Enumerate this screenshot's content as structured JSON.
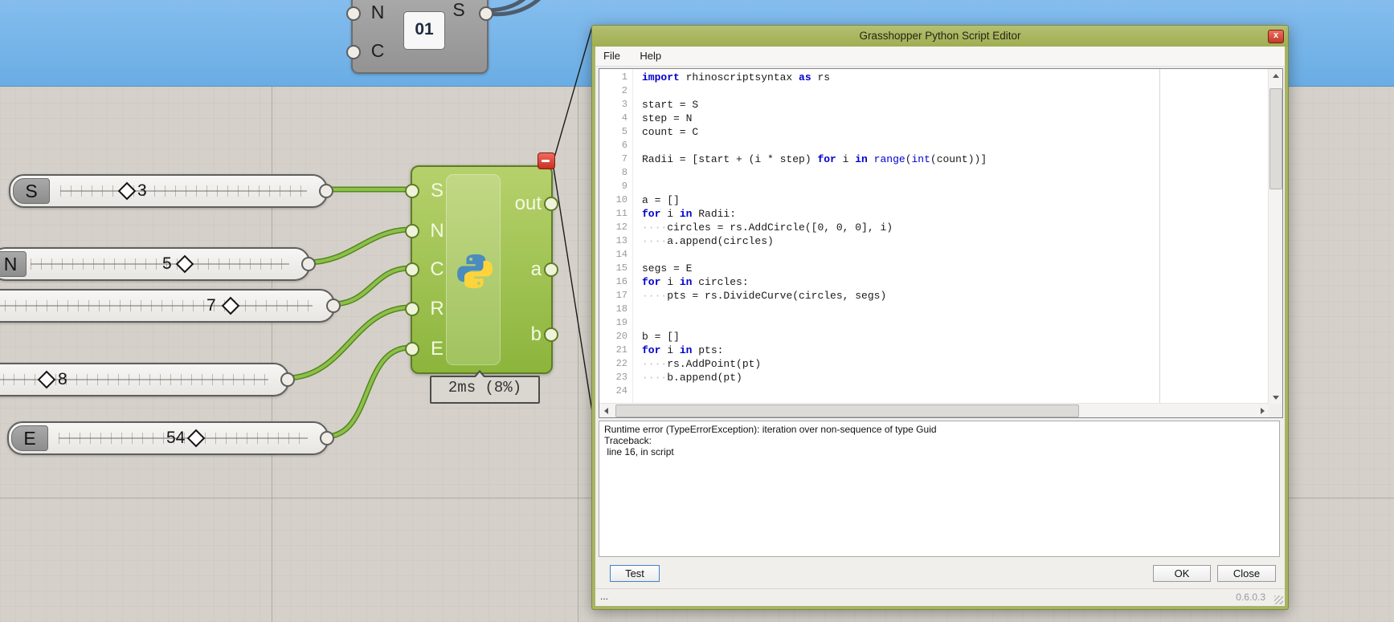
{
  "colors": {
    "sky": "#79b6e8",
    "canvas": "#d5d1ca",
    "accent_olive": "#a9b464",
    "wire_green": "#7db63e",
    "component_green": "#9cc04a",
    "error_red": "#d64541"
  },
  "canvas": {
    "series_component": {
      "input_top": "N",
      "input_bottom": "C",
      "output_label": "S",
      "icon_text": "01"
    },
    "sliders": [
      {
        "label": "S",
        "value": "3"
      },
      {
        "label": "N",
        "value": "5"
      },
      {
        "label": "",
        "value": "7"
      },
      {
        "label": "",
        "value": "8"
      },
      {
        "label": "E",
        "value": "54"
      }
    ],
    "python_component": {
      "inputs": [
        "S",
        "N",
        "C",
        "R",
        "E"
      ],
      "outputs": [
        "out",
        "a",
        "b"
      ],
      "runtime_label": "2ms (8%)"
    }
  },
  "dialog": {
    "title": "Grasshopper Python Script Editor",
    "close_label": "x",
    "menu": [
      "File",
      "Help"
    ],
    "editor": {
      "lines": [
        {
          "n": "1",
          "segs": [
            [
              "k",
              "import"
            ],
            [
              "p",
              " rhinoscriptsyntax "
            ],
            [
              "k",
              "as"
            ],
            [
              "p",
              " rs"
            ]
          ]
        },
        {
          "n": "2",
          "segs": []
        },
        {
          "n": "3",
          "segs": [
            [
              "p",
              "start = S"
            ]
          ]
        },
        {
          "n": "4",
          "segs": [
            [
              "p",
              "step = N"
            ]
          ]
        },
        {
          "n": "5",
          "segs": [
            [
              "p",
              "count = C"
            ]
          ]
        },
        {
          "n": "6",
          "segs": []
        },
        {
          "n": "7",
          "segs": [
            [
              "p",
              "Radii = [start + (i * step) "
            ],
            [
              "k",
              "for"
            ],
            [
              "p",
              " i "
            ],
            [
              "k",
              "in"
            ],
            [
              "p",
              " "
            ],
            [
              "b",
              "range"
            ],
            [
              "p",
              "("
            ],
            [
              "b",
              "int"
            ],
            [
              "p",
              "(count))]"
            ]
          ]
        },
        {
          "n": "8",
          "segs": []
        },
        {
          "n": "9",
          "segs": []
        },
        {
          "n": "10",
          "segs": [
            [
              "p",
              "a = []"
            ]
          ]
        },
        {
          "n": "11",
          "segs": [
            [
              "k",
              "for"
            ],
            [
              "p",
              " i "
            ],
            [
              "k",
              "in"
            ],
            [
              "p",
              " Radii:"
            ]
          ]
        },
        {
          "n": "12",
          "segs": [
            [
              "w",
              "····"
            ],
            [
              "p",
              "circles = rs.AddCircle([0, 0, 0], i)"
            ]
          ]
        },
        {
          "n": "13",
          "segs": [
            [
              "w",
              "····"
            ],
            [
              "p",
              "a.append(circles)"
            ]
          ]
        },
        {
          "n": "14",
          "segs": []
        },
        {
          "n": "15",
          "segs": [
            [
              "p",
              "segs = E"
            ]
          ]
        },
        {
          "n": "16",
          "segs": [
            [
              "k",
              "for"
            ],
            [
              "p",
              " i "
            ],
            [
              "k",
              "in"
            ],
            [
              "p",
              " circles:"
            ]
          ]
        },
        {
          "n": "17",
          "segs": [
            [
              "w",
              "····"
            ],
            [
              "p",
              "pts = rs.DivideCurve(circles, segs)"
            ]
          ]
        },
        {
          "n": "18",
          "segs": []
        },
        {
          "n": "19",
          "segs": []
        },
        {
          "n": "20",
          "segs": [
            [
              "p",
              "b = []"
            ]
          ]
        },
        {
          "n": "21",
          "segs": [
            [
              "k",
              "for"
            ],
            [
              "p",
              " i "
            ],
            [
              "k",
              "in"
            ],
            [
              "p",
              " pts:"
            ]
          ]
        },
        {
          "n": "22",
          "segs": [
            [
              "w",
              "····"
            ],
            [
              "p",
              "rs.AddPoint(pt)"
            ]
          ]
        },
        {
          "n": "23",
          "segs": [
            [
              "w",
              "····"
            ],
            [
              "p",
              "b.append(pt)"
            ]
          ]
        },
        {
          "n": "24",
          "segs": []
        }
      ]
    },
    "console_lines": [
      "Runtime error (TypeErrorException): iteration over non-sequence of type Guid",
      "Traceback:",
      " line 16, in script"
    ],
    "buttons": {
      "test": "Test",
      "ok": "OK",
      "close": "Close"
    },
    "status": {
      "left": "...",
      "version": "0.6.0.3"
    }
  }
}
